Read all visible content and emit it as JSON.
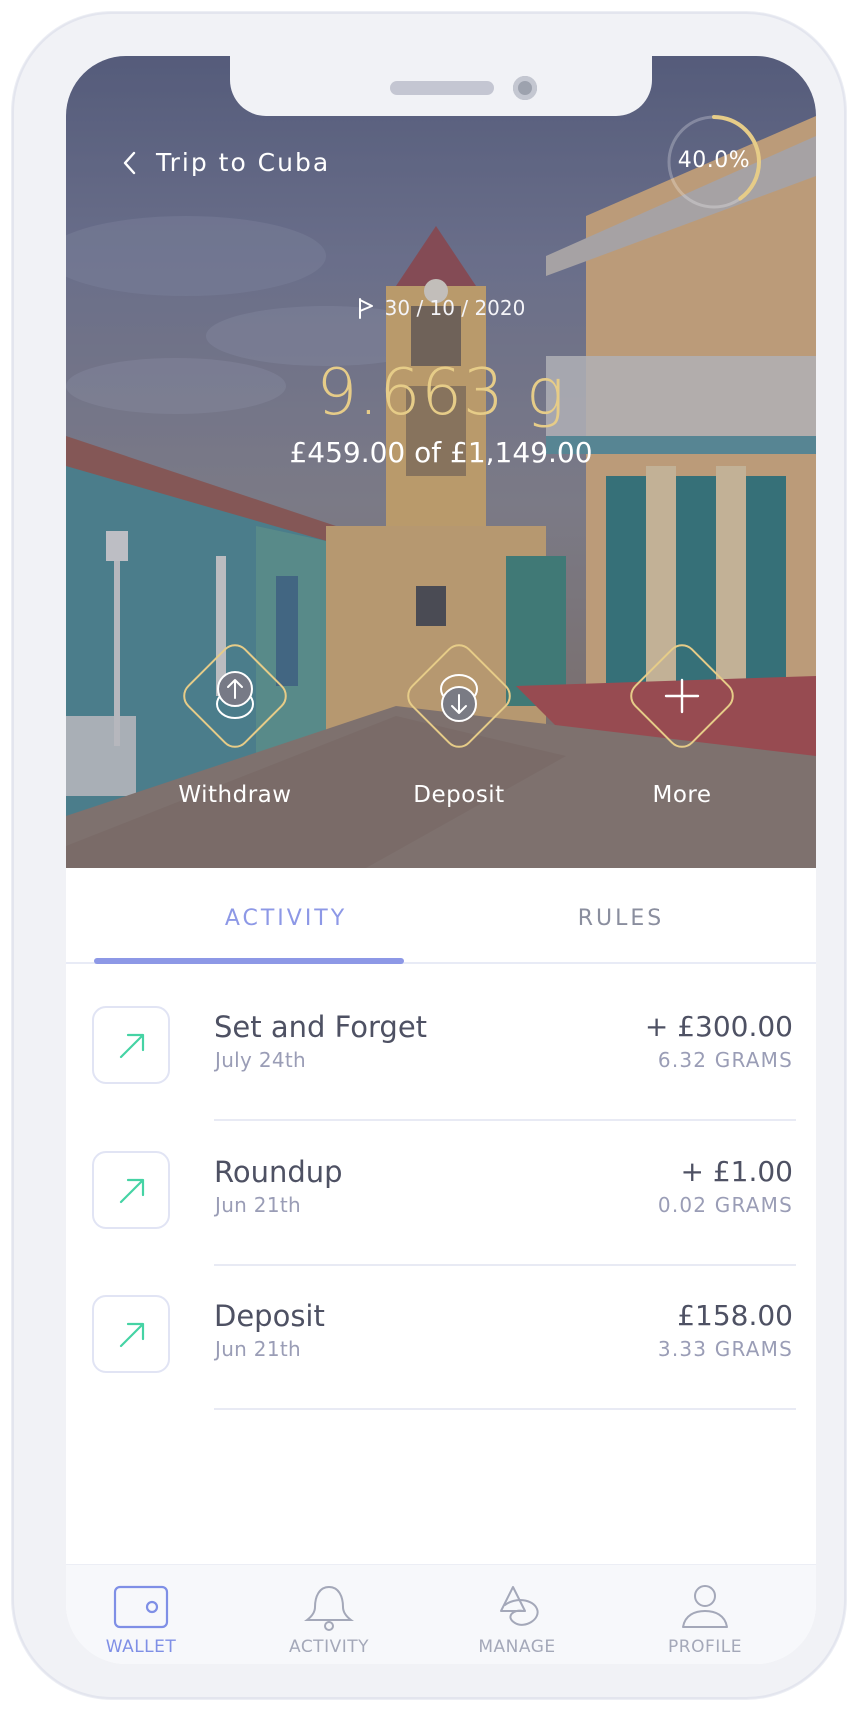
{
  "header": {
    "title": "Trip to Cuba",
    "progress_label": "40.0%",
    "progress": 0.4,
    "target_date": "30 / 10 / 2020",
    "grams": "9.663 g",
    "amount_text": "£459.00 of £1,149.00"
  },
  "actions": [
    {
      "label": "Withdraw",
      "icon": "withdraw-coins-icon"
    },
    {
      "label": "Deposit",
      "icon": "deposit-coins-icon"
    },
    {
      "label": "More",
      "icon": "plus-icon"
    }
  ],
  "tabs": [
    {
      "label": "ACTIVITY",
      "active": true
    },
    {
      "label": "RULES",
      "active": false
    }
  ],
  "activity": [
    {
      "title": "Set and Forget",
      "date": "July 24th",
      "amount": "+ £300.00",
      "grams": "6.32 GRAMS",
      "icon": "arrow-up-right-icon"
    },
    {
      "title": "Roundup",
      "date": "Jun 21th",
      "amount": "+ £1.00",
      "grams": "0.02 GRAMS",
      "icon": "arrow-up-right-icon"
    },
    {
      "title": "Deposit",
      "date": "Jun 21th",
      "amount": "£158.00",
      "grams": "3.33 GRAMS",
      "icon": "arrow-up-right-icon"
    }
  ],
  "nav": [
    {
      "label": "WALLET",
      "icon": "wallet-icon",
      "active": true
    },
    {
      "label": "ACTIVITY",
      "icon": "bell-icon",
      "active": false
    },
    {
      "label": "MANAGE",
      "icon": "manage-icon",
      "active": false
    },
    {
      "label": "PROFILE",
      "icon": "profile-icon",
      "active": false
    }
  ],
  "colors": {
    "accent": "#8d98e6",
    "gold": "#e6cc88",
    "teal_icon": "#45d3a4",
    "text_dark": "#4e5163",
    "text_muted": "#9a9db6"
  }
}
